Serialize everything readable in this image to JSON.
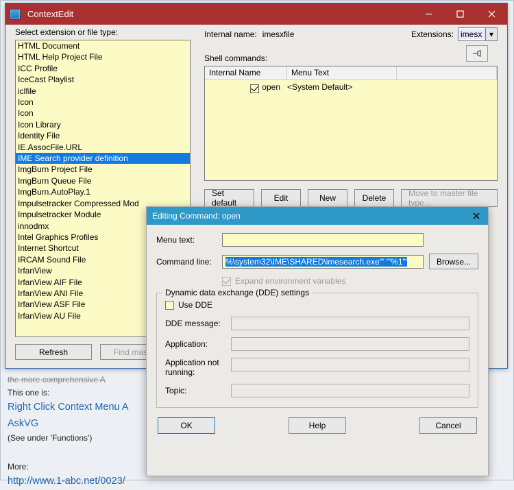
{
  "page": {
    "line_cut": "the more comprehensive A",
    "this_one": "This one is:",
    "link1": "Right Click Context Menu A",
    "link2": "AskVG",
    "see_under": "(See under 'Functions')",
    "more": "More:",
    "link3": "http://www.1-abc.net/0023/"
  },
  "main": {
    "title": "ContextEdit",
    "select_label": "Select extension or file type:",
    "items": [
      "HTML Document",
      "HTML Help Project File",
      "ICC Profile",
      "IceCast Playlist",
      "iclfile",
      "Icon",
      "Icon",
      "Icon Library",
      "Identity File",
      "IE.AssocFile.URL",
      "IME Search provider definition",
      "ImgBurn Project File",
      "ImgBurn Queue File",
      "ImgBurn.AutoPlay.1",
      "Impulsetracker Compressed Mod",
      "Impulsetracker Module",
      "innodmx",
      "Intel Graphics Profiles",
      "Internet Shortcut",
      "IRCAM Sound File",
      "IrfanView",
      "IrfanView AIF File",
      "IrfanView ANI File",
      "IrfanView ASF File",
      "IrfanView AU File"
    ],
    "selected_index": 10,
    "refresh": "Refresh",
    "find_master": "Find master...",
    "internal_name_label": "Internal name:",
    "internal_name_value": "imesxfile",
    "extensions_label": "Extensions:",
    "extensions_value": "imesx",
    "shell_label": "Shell commands:",
    "col_internal": "Internal Name",
    "col_menu": "Menu Text",
    "row_name": "open",
    "row_menu": "<System Default>",
    "btn_setdefault": "Set default",
    "btn_edit": "Edit",
    "btn_new": "New",
    "btn_delete": "Delete",
    "btn_move": "Move to master file type..."
  },
  "dlg": {
    "title": "Editing Command: open",
    "menu_text_label": "Menu text:",
    "menu_text_value": "",
    "cmd_label": "Command line:",
    "cmd_value": "%\\system32\\IME\\SHARED\\imesearch.exe\"' '\"%1\"'",
    "browse": "Browse...",
    "expand_env": "Expand environment variables",
    "group_title": "Dynamic data exchange (DDE) settings",
    "use_dde": "Use DDE",
    "dde_msg": "DDE message:",
    "application": "Application:",
    "app_not_running": "Application not running:",
    "topic": "Topic:",
    "ok": "OK",
    "help": "Help",
    "cancel": "Cancel"
  }
}
